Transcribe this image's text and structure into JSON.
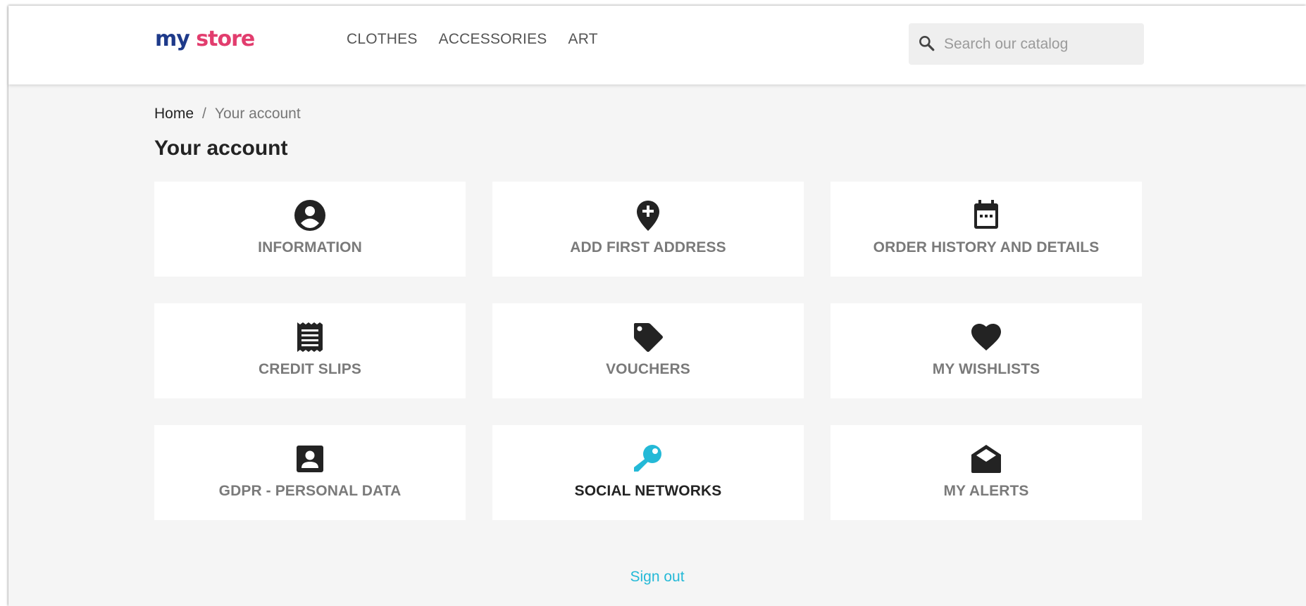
{
  "logo": {
    "part1": "my",
    "part2": " store"
  },
  "nav": {
    "items": [
      "CLOTHES",
      "ACCESSORIES",
      "ART"
    ]
  },
  "search": {
    "placeholder": "Search our catalog",
    "value": ""
  },
  "breadcrumb": {
    "home": "Home",
    "separator": "/",
    "current": "Your account"
  },
  "page": {
    "title": "Your account"
  },
  "cards": [
    {
      "label": "INFORMATION",
      "icon": "account-circle-icon"
    },
    {
      "label": "ADD FIRST ADDRESS",
      "icon": "add-location-icon"
    },
    {
      "label": "ORDER HISTORY AND DETAILS",
      "icon": "calendar-icon"
    },
    {
      "label": "CREDIT SLIPS",
      "icon": "receipt-icon"
    },
    {
      "label": "VOUCHERS",
      "icon": "tag-icon"
    },
    {
      "label": "MY WISHLISTS",
      "icon": "heart-icon"
    },
    {
      "label": "GDPR - PERSONAL DATA",
      "icon": "account-box-icon"
    },
    {
      "label": "SOCIAL NETWORKS",
      "icon": "key-icon"
    },
    {
      "label": "MY ALERTS",
      "icon": "open-mail-icon"
    }
  ],
  "signout": {
    "label": "Sign out"
  },
  "colors": {
    "accent": "#24b9d7",
    "icon": "#232323",
    "label": "#7a7a7a",
    "background": "#f5f5f5"
  }
}
